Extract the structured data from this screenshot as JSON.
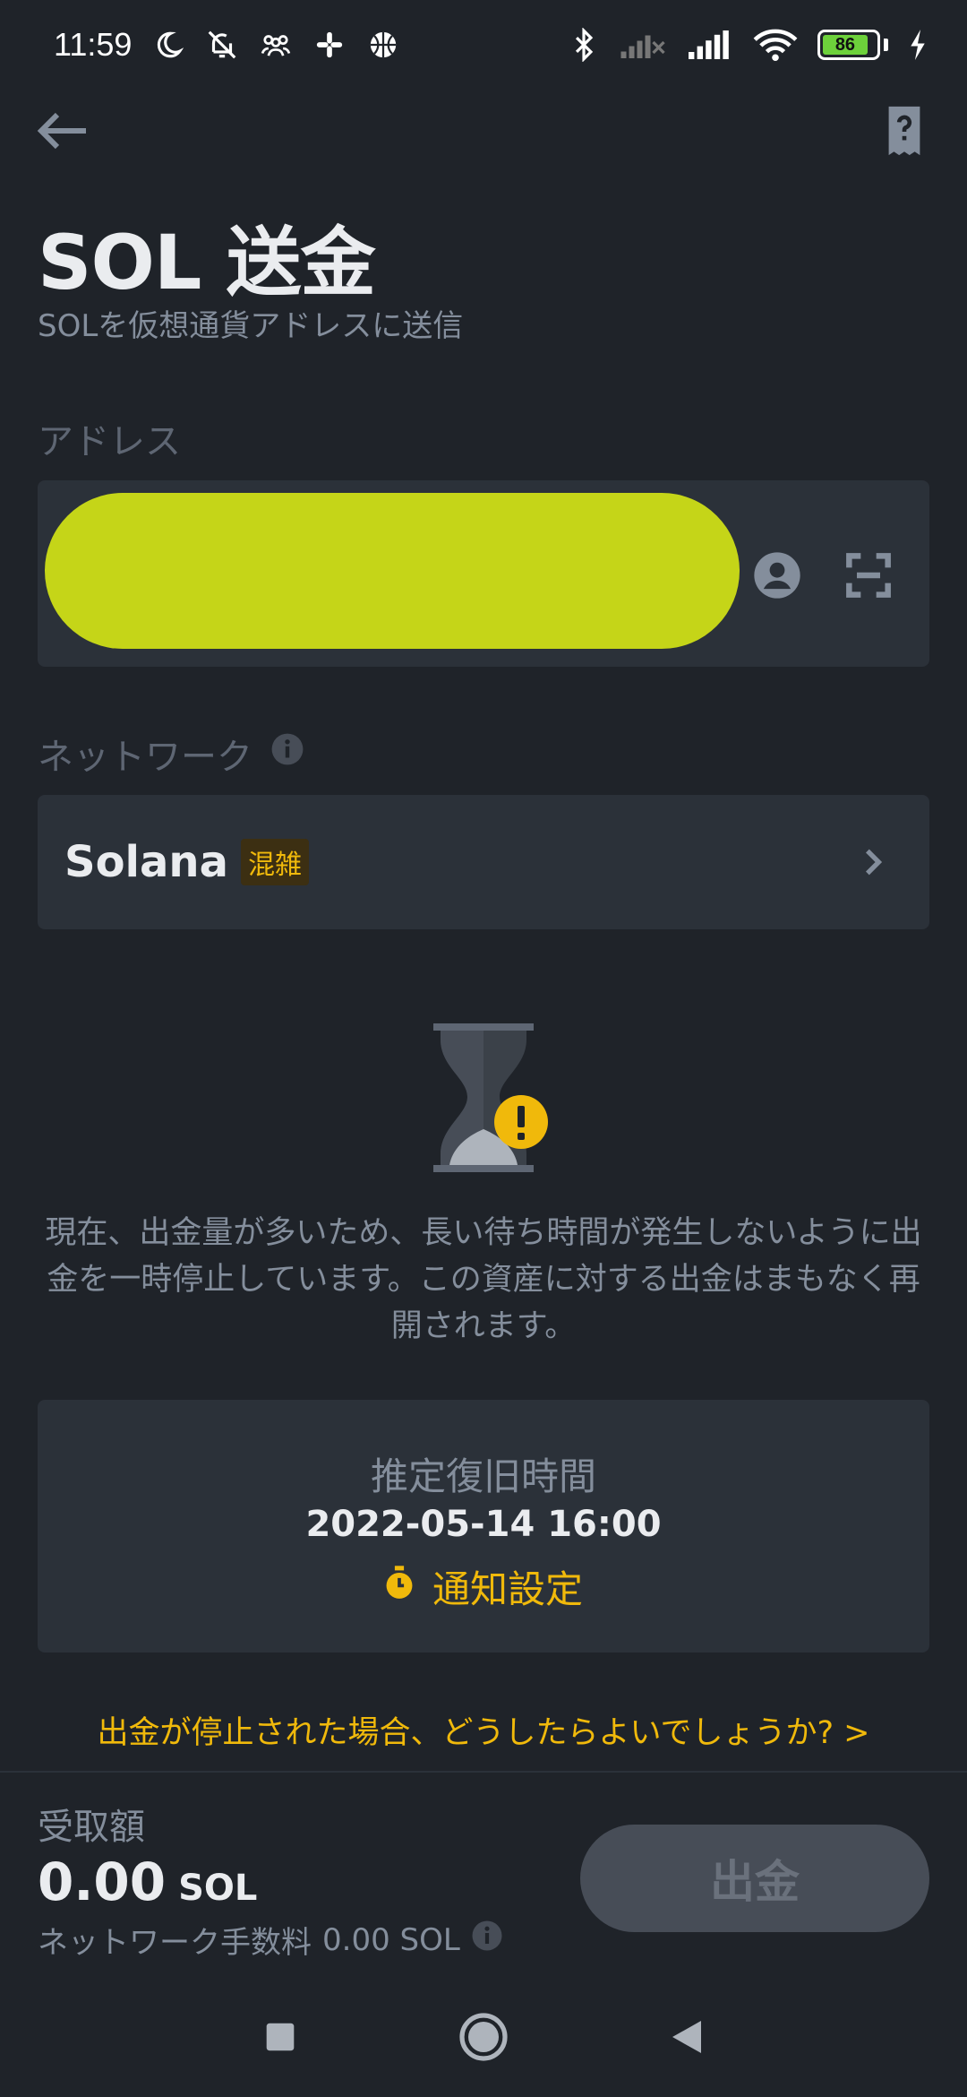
{
  "status_bar": {
    "time": "11:59",
    "battery": "86",
    "icons": [
      "moon-icon",
      "notifications-off-icon",
      "group-icon",
      "slack-icon",
      "basketball-icon",
      "bluetooth-icon",
      "signal-off-icon",
      "signal-icon",
      "wifi-icon",
      "battery-icon",
      "charging-icon"
    ]
  },
  "header": {
    "back_icon": "arrow-left-icon",
    "help_icon": "help-document-icon"
  },
  "title": "SOL 送金",
  "subtitle": "SOLを仮想通貨アドレスに送信",
  "address": {
    "label": "アドレス",
    "icons": [
      "contact-icon",
      "scan-icon"
    ],
    "redaction_color": "#c5d518"
  },
  "network": {
    "label": "ネットワーク",
    "name": "Solana",
    "badge": "混雑"
  },
  "notice": "現在、出金量が多いため、長い待ち時間が発生しないように出金を一時停止しています。この資産に対する出金はまもなく再開されます。",
  "recovery": {
    "title": "推定復旧時間",
    "time": "2022-05-14 16:00",
    "notify_label": "通知設定"
  },
  "help_link": "出金が停止された場合、どうしたらよいでしょうか? >",
  "footer": {
    "receive_label": "受取額",
    "amount": "0.00",
    "unit": "SOL",
    "fee_label": "ネットワーク手数料",
    "fee_value": "0.00 SOL",
    "withdraw_label": "出金"
  },
  "colors": {
    "background": "#1f2329",
    "card": "#2b3139",
    "accent": "#f0b90b",
    "muted": "#848e9c"
  }
}
